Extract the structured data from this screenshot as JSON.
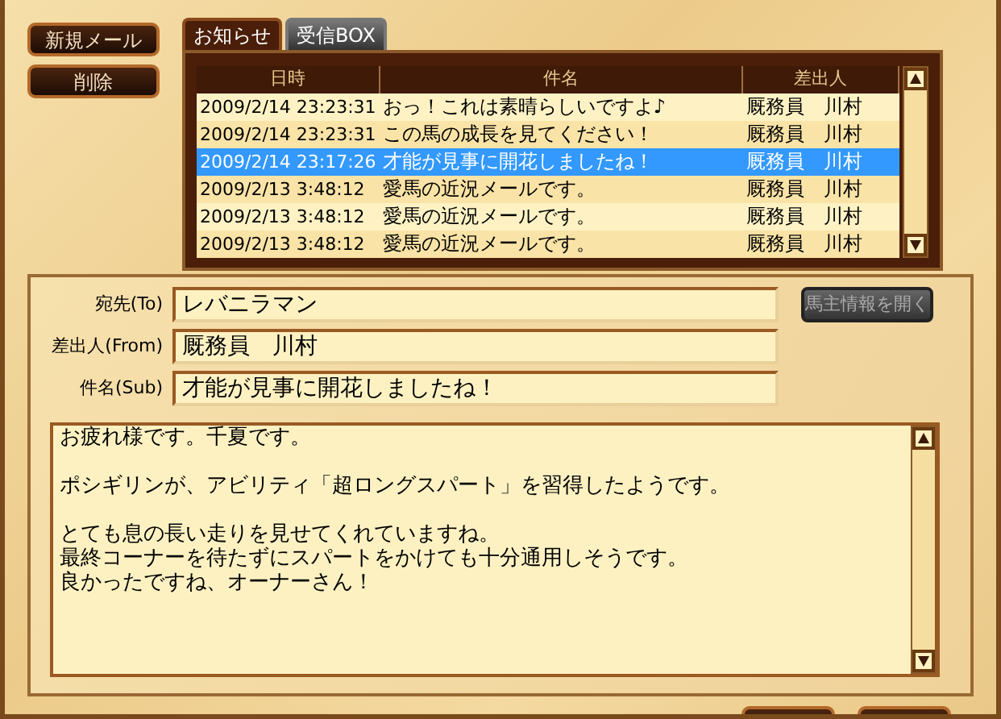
{
  "buttons": [
    {
      "label": "新規メール"
    },
    {
      "label": "削除"
    }
  ],
  "tabs": [
    {
      "label": "お知らせ",
      "selected": true
    },
    {
      "label": "受信BOX",
      "selected": false
    }
  ],
  "mail_list": {
    "columns": [
      "日時",
      "件名",
      "差出人"
    ],
    "rows": [
      {
        "date": "2009/2/14 23:23:31",
        "subject": "おっ！これは素晴らしいですよ♪",
        "sender": "厩務員　川村",
        "selected": false
      },
      {
        "date": "2009/2/14 23:23:31",
        "subject": "この馬の成長を見てください！",
        "sender": "厩務員　川村",
        "selected": false
      },
      {
        "date": "2009/2/14 23:17:26",
        "subject": "才能が見事に開花しましたね！",
        "sender": "厩務員　川村",
        "selected": true
      },
      {
        "date": "2009/2/13 3:48:12",
        "subject": "愛馬の近況メールです。",
        "sender": "厩務員　川村",
        "selected": false
      },
      {
        "date": "2009/2/13 3:48:12",
        "subject": "愛馬の近況メールです。",
        "sender": "厩務員　川村",
        "selected": false
      },
      {
        "date": "2009/2/13 3:48:12",
        "subject": "愛馬の近況メールです。",
        "sender": "厩務員　川村",
        "selected": false
      }
    ]
  },
  "detail": {
    "fields": [
      {
        "label": "宛先(To)",
        "value": "レバニラマン"
      },
      {
        "label": "差出人(From)",
        "value": "厩務員　川村"
      },
      {
        "label": "件名(Sub)",
        "value": "才能が見事に開花しましたね！"
      }
    ],
    "owner_button": {
      "label": "馬主情報を開く",
      "disabled": true
    },
    "body": [
      [
        "お疲れ様です。千夏です。"
      ],
      [
        "ポシギリンが、アビリティ「超ロングスパート」を習得したようです。"
      ],
      [
        "とても息の長い走りを見せてくれていますね。",
        "最終コーナーを待たずにスパートをかけても十分通用しそうです。",
        "良かったですね、オーナーさん！"
      ]
    ]
  }
}
